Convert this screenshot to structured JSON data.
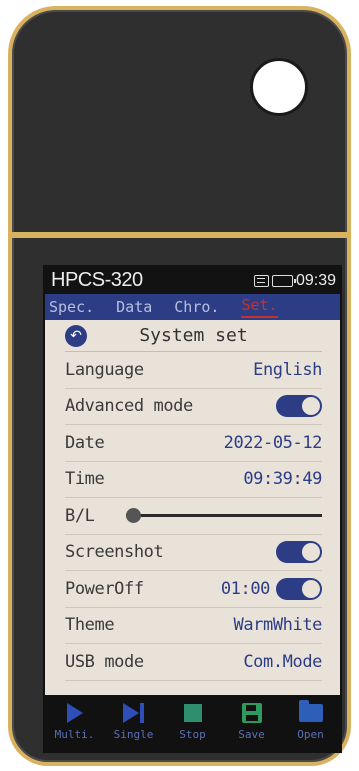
{
  "status": {
    "device_name": "HPCS-320",
    "time": "09:39"
  },
  "tabs": [
    "Spec.",
    "Data",
    "Chro.",
    "Set."
  ],
  "active_tab": 3,
  "panel": {
    "title": "System set"
  },
  "settings": {
    "language": {
      "label": "Language",
      "value": "English"
    },
    "advanced_mode": {
      "label": "Advanced mode",
      "on": true
    },
    "date": {
      "label": "Date",
      "value": "2022-05-12"
    },
    "time": {
      "label": "Time",
      "value": "09:39:49"
    },
    "backlight": {
      "label": "B/L",
      "level": 0.0
    },
    "screenshot": {
      "label": "Screenshot",
      "on": true
    },
    "poweroff": {
      "label": "PowerOff",
      "value": "01:00",
      "on": true
    },
    "theme": {
      "label": "Theme",
      "value": "WarmWhite"
    },
    "usb_mode": {
      "label": "USB mode",
      "value": "Com.Mode"
    }
  },
  "toolbar": [
    {
      "label": "Multi.",
      "icon": "play-icon"
    },
    {
      "label": "Single",
      "icon": "step-icon"
    },
    {
      "label": "Stop",
      "icon": "stop-icon"
    },
    {
      "label": "Save",
      "icon": "save-icon"
    },
    {
      "label": "Open",
      "icon": "folder-icon"
    }
  ],
  "colors": {
    "accent": "#2c3d86",
    "bezel": "#d8b25f",
    "body": "#2f2f2f",
    "screen_bg": "#e9e2d9",
    "active_tab": "#c63030"
  }
}
